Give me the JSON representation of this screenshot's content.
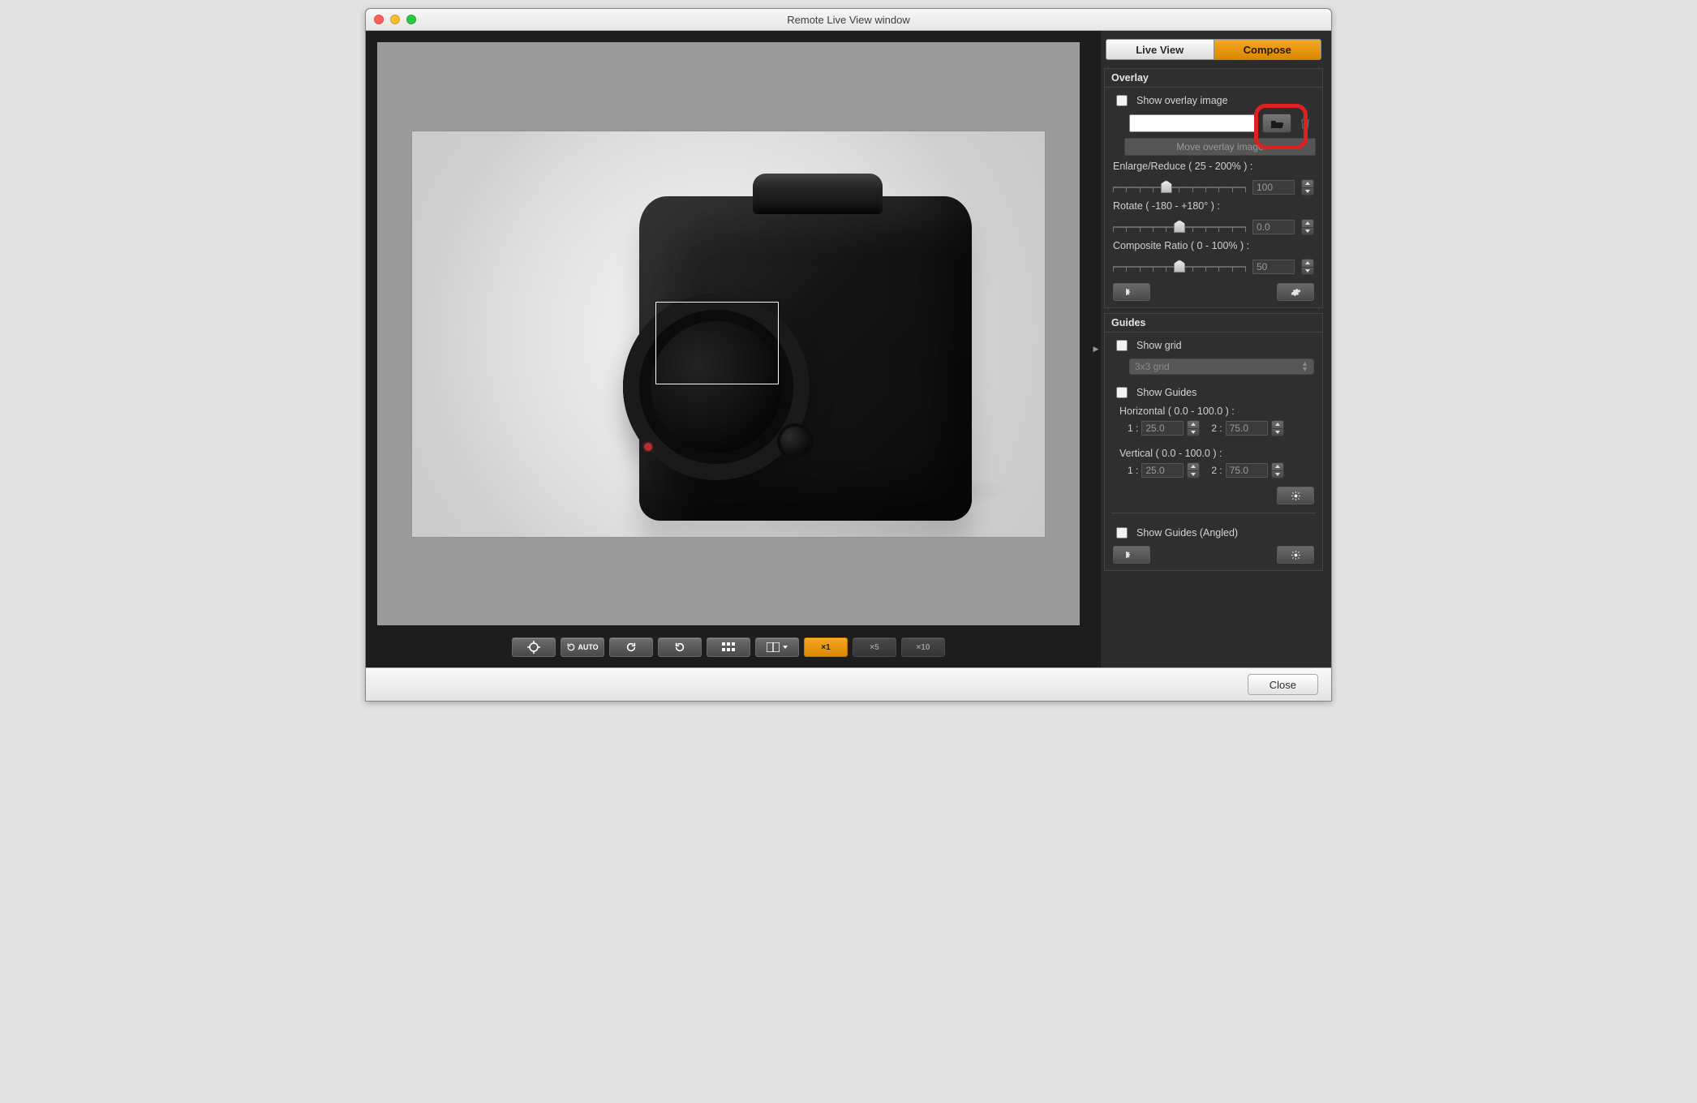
{
  "window": {
    "title": "Remote Live View window"
  },
  "tabs": {
    "live_view": "Live View",
    "compose": "Compose"
  },
  "overlay": {
    "section_title": "Overlay",
    "show_overlay": "Show overlay image",
    "move_overlay": "Move overlay image",
    "enlarge_label": "Enlarge/Reduce ( 25 - 200% ) :",
    "enlarge_value": "100",
    "rotate_label": "Rotate ( -180 - +180° ) :",
    "rotate_value": "0.0",
    "ratio_label": "Composite Ratio ( 0 - 100% ) :",
    "ratio_value": "50"
  },
  "guides": {
    "section_title": "Guides",
    "show_grid": "Show grid",
    "grid_type": "3x3 grid",
    "show_guides": "Show Guides",
    "h_label": "Horizontal ( 0.0 - 100.0 ) :",
    "v_label": "Vertical ( 0.0 - 100.0 ) :",
    "one": "1 :",
    "two": "2 :",
    "h1": "25.0",
    "h2": "75.0",
    "v1": "25.0",
    "v2": "75.0",
    "show_guides_angled": "Show Guides (Angled)"
  },
  "toolbar": {
    "auto": "AUTO",
    "zoom_x1": "×1",
    "zoom_x5": "×5",
    "zoom_x10": "×10"
  },
  "footer": {
    "close": "Close"
  }
}
